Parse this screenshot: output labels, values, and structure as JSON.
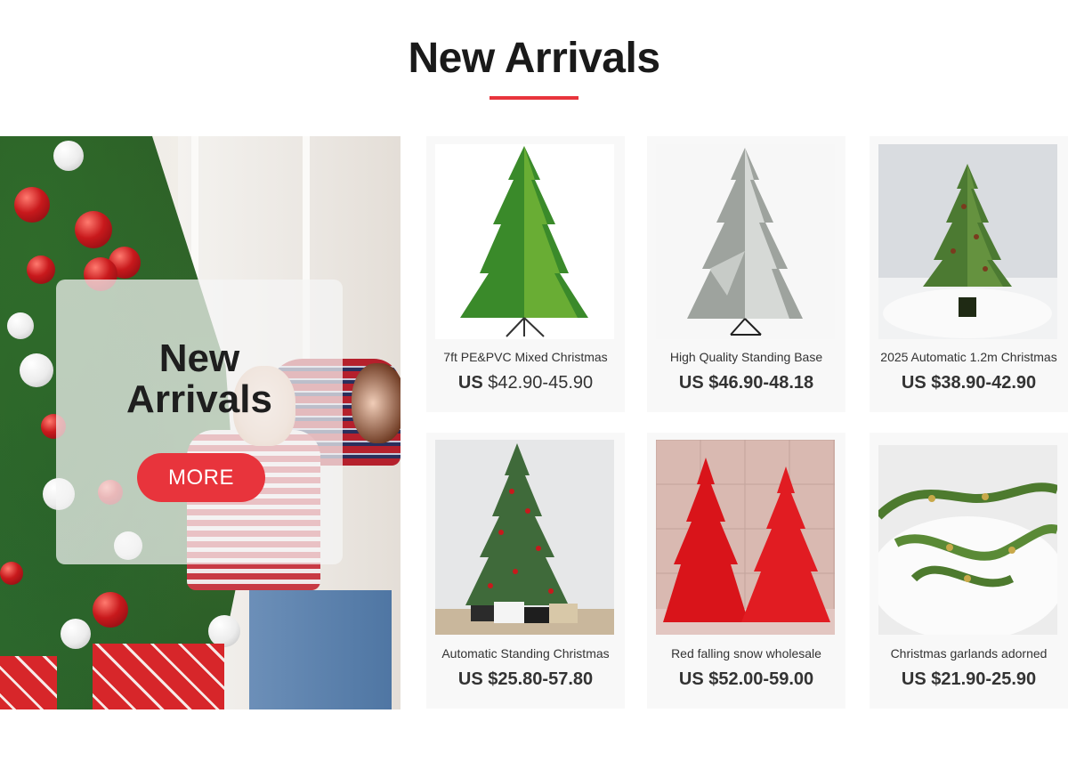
{
  "section": {
    "title": "New Arrivals",
    "accent_color": "#e8343c"
  },
  "hero": {
    "title_line1": "New",
    "title_line2": "Arrivals",
    "button_label": "MORE"
  },
  "products": [
    {
      "name": "7ft PE&PVC Mixed Christmas",
      "currency": "US",
      "price": "$42.90-45.90",
      "image_icon": "green-christmas-tree-image"
    },
    {
      "name": "High Quality Standing Base",
      "currency": "US",
      "price": "$46.90-48.18",
      "image_icon": "flocked-white-christmas-tree-image"
    },
    {
      "name": "2025 Automatic 1.2m Christmas",
      "currency": "US",
      "price": "$38.90-42.90",
      "image_icon": "potted-christmas-tree-image"
    },
    {
      "name": "Automatic Standing Christmas",
      "currency": "US",
      "price": "$25.80-57.80",
      "image_icon": "decorated-christmas-tree-image"
    },
    {
      "name": "Red falling snow wholesale",
      "currency": "US",
      "price": "$52.00-59.00",
      "image_icon": "red-christmas-trees-image"
    },
    {
      "name": "Christmas garlands adorned",
      "currency": "US",
      "price": "$21.90-25.90",
      "image_icon": "christmas-garland-image"
    }
  ]
}
